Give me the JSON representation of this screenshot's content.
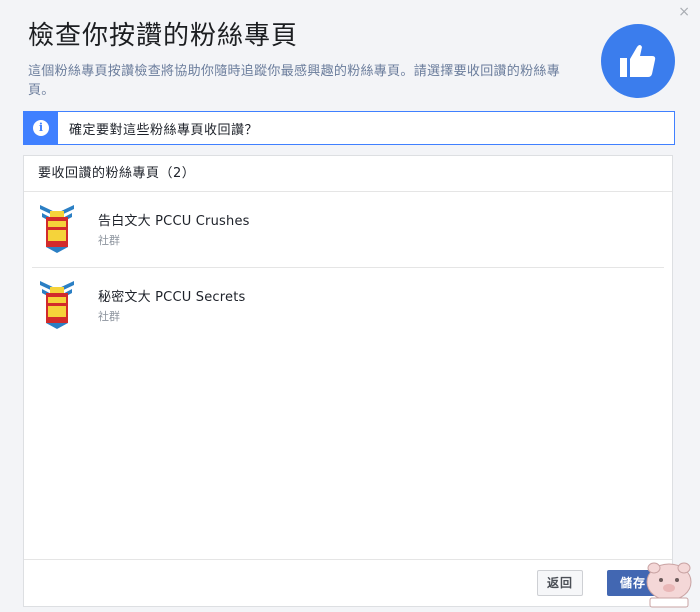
{
  "dialog": {
    "title": "檢查你按讚的粉絲專頁",
    "description": "這個粉絲專頁按讚檢查將協助你隨時追蹤你最感興趣的粉絲專頁。請選擇要收回讚的粉絲專頁。",
    "close_label": "×",
    "header_icon": "thumbs-up-icon",
    "accent_color": "#3b7ded"
  },
  "notice": {
    "icon": "info-icon",
    "icon_glyph": "i",
    "text": "確定要對這些粉絲專頁收回讚？"
  },
  "list": {
    "heading": "要收回讚的粉絲專頁（2）",
    "items": [
      {
        "name": "告白文大 PCCU Crushes",
        "category": "社群",
        "icon": "pccu-logo"
      },
      {
        "name": "秘密文大 PCCU Secrets",
        "category": "社群",
        "icon": "pccu-logo"
      }
    ]
  },
  "footer": {
    "back_label": "返回",
    "save_label": "儲存",
    "save_color": "#4267b2"
  }
}
